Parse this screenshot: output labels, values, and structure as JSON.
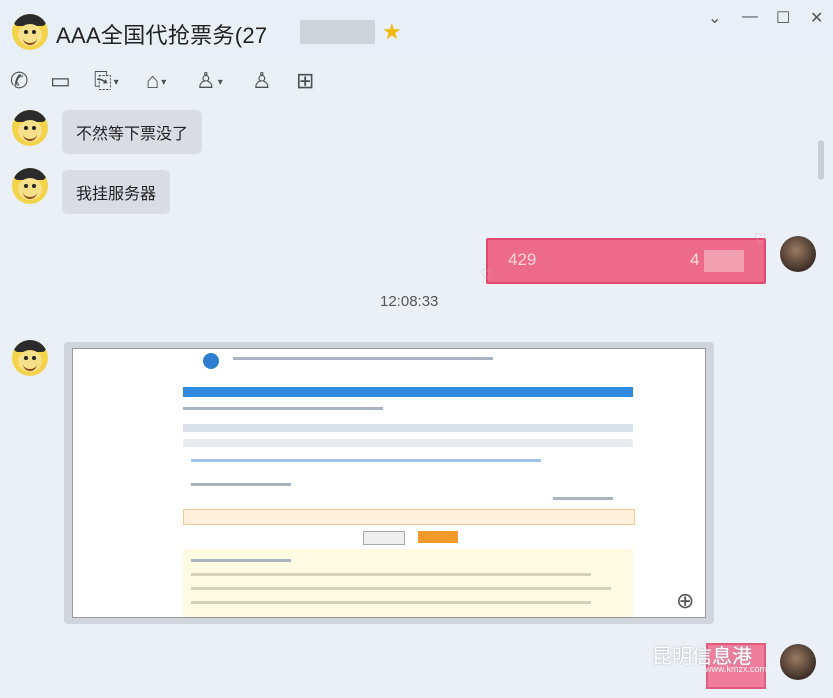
{
  "window": {
    "title": "AAA全国代抢票务(27",
    "controls": [
      "⌄",
      "—",
      "☐",
      "✕"
    ]
  },
  "toolbar": {
    "icons": [
      "phone-icon",
      "video-icon",
      "share-screen-icon",
      "remote-assist-icon",
      "group-invite-icon",
      "add-member-icon",
      "screenshot-icon"
    ]
  },
  "messages": [
    {
      "text": "不然等下票没了"
    },
    {
      "text": "我挂服务器"
    }
  ],
  "my_message": {
    "part1": "429",
    "part2": "4"
  },
  "timestamp": "12:08:33",
  "watermark": {
    "text": "昆明信息港",
    "url": "www.kmzx.com.cn"
  },
  "colors": {
    "accent": "#ee6a8a",
    "bubble": "#d9dde3",
    "background": "#eaf0f6"
  }
}
